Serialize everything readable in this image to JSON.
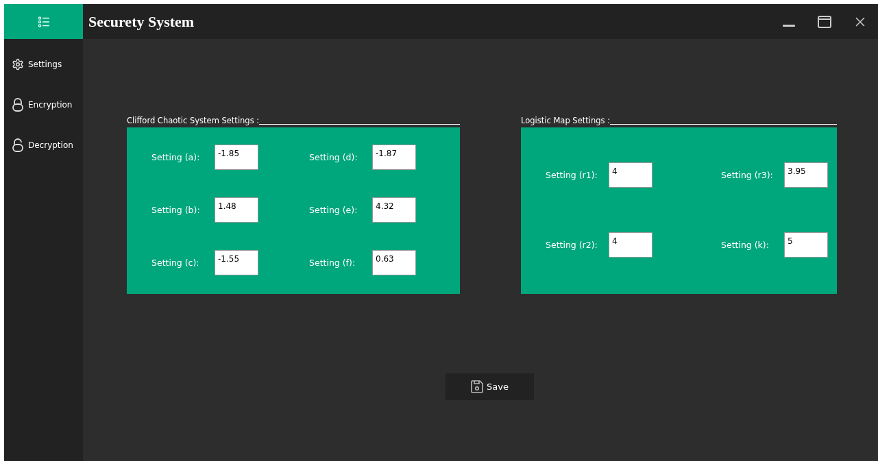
{
  "window": {
    "title": "Securety System"
  },
  "sidebar": {
    "items": [
      {
        "label": "Settings",
        "kind": "gear"
      },
      {
        "label": "Encryption",
        "kind": "lock"
      },
      {
        "label": "Decryption",
        "kind": "unlock"
      }
    ]
  },
  "groups": [
    {
      "title": "Clifford Chaotic System Settings :",
      "fields": [
        {
          "label": "Setting (a):",
          "value": "-1.85"
        },
        {
          "label": "Setting (d):",
          "value": "-1.87"
        },
        {
          "label": "Setting (b):",
          "value": "1.48"
        },
        {
          "label": "Setting (e):",
          "value": "4.32"
        },
        {
          "label": "Setting (c):",
          "value": "-1.55"
        },
        {
          "label": "Setting (f):",
          "value": "0.63"
        }
      ]
    },
    {
      "title": "Logistic Map Settings :",
      "fields": [
        {
          "label": "Setting (r1):",
          "value": "4"
        },
        {
          "label": "Setting (r3):",
          "value": "3.95"
        },
        {
          "label": "Setting (r2):",
          "value": "4"
        },
        {
          "label": "Setting (k):",
          "value": "5"
        }
      ]
    }
  ],
  "save_button": {
    "label": "Save"
  }
}
